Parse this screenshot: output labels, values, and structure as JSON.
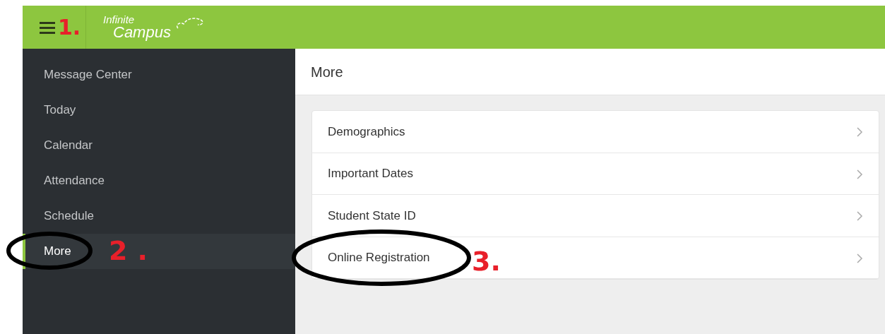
{
  "header": {
    "logo_line_1": "Infinite",
    "logo_line_2": "Campus",
    "annotation": "1."
  },
  "sidebar": {
    "items": [
      {
        "label": "Message Center",
        "selected": false
      },
      {
        "label": "Today",
        "selected": false
      },
      {
        "label": "Calendar",
        "selected": false
      },
      {
        "label": "Attendance",
        "selected": false
      },
      {
        "label": "Schedule",
        "selected": false
      },
      {
        "label": "More",
        "selected": true,
        "annotation": "2."
      }
    ]
  },
  "main": {
    "title": "More",
    "items": [
      {
        "label": "Demographics"
      },
      {
        "label": "Important Dates"
      },
      {
        "label": "Student State ID"
      },
      {
        "label": "Online Registration",
        "annotation": "3."
      }
    ]
  }
}
